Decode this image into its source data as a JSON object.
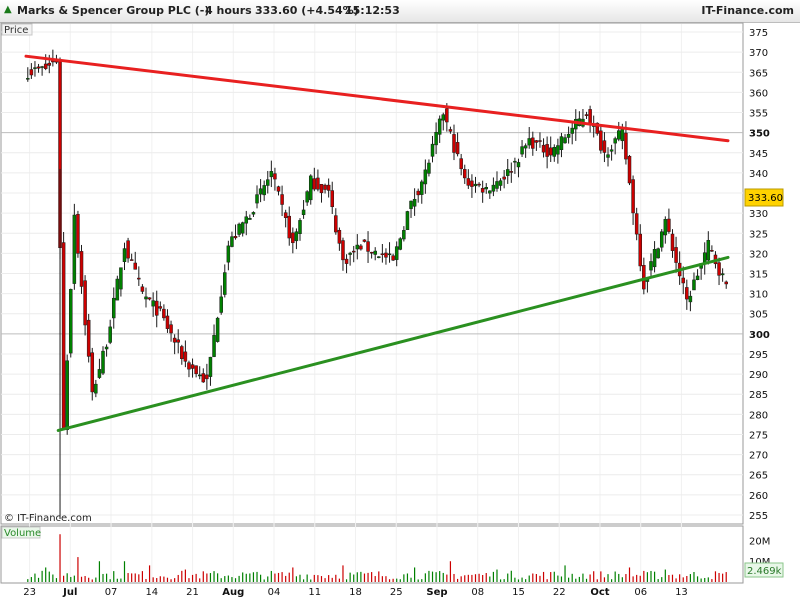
{
  "header": {
    "instrument": "Marks & Spencer Group PLC (-)",
    "timeframe": "4 hours",
    "price_change": "333.60 (+4.54%)",
    "time": "15:12:53",
    "brand": "IT-Finance.com",
    "watermark": "© IT-Finance.com"
  },
  "panels": {
    "price_label": "Price",
    "volume_label": "Volume"
  },
  "colors": {
    "up": "#008000",
    "down": "#cc0000",
    "resistance": "#e82020",
    "support": "#2a9020",
    "last_badge": "#ffd200",
    "vol_badge": "#e8f7e8"
  },
  "chart_data": {
    "type": "candlestick",
    "title": "Marks & Spencer Group PLC (-)",
    "timeframe": "4 hours",
    "last_price": "333.60",
    "change": "+4.54%",
    "ylim": [
      253,
      377
    ],
    "x_ticks": [
      "23",
      "Jul",
      "07",
      "14",
      "21",
      "Aug",
      "04",
      "11",
      "18",
      "25",
      "Sep",
      "08",
      "15",
      "22",
      "Oct",
      "06",
      "13"
    ],
    "y_ticks": [
      255,
      260,
      265,
      270,
      275,
      280,
      285,
      290,
      295,
      300,
      305,
      310,
      315,
      320,
      325,
      330,
      335,
      340,
      345,
      350,
      355,
      360,
      365,
      370,
      375
    ],
    "y_ticks_bold": [
      300,
      350
    ],
    "close_path_index": [
      0,
      5,
      8,
      10,
      13,
      18,
      22,
      27,
      32,
      37,
      44,
      50,
      56,
      62,
      68,
      74,
      79,
      84,
      88,
      93,
      98,
      102,
      106,
      111,
      116,
      122,
      128,
      134,
      140,
      146,
      151,
      156,
      161,
      166,
      172,
      178,
      184,
      190,
      196
    ],
    "close_path_values": [
      365,
      366,
      368,
      276,
      330,
      285,
      298,
      322,
      310,
      305,
      293,
      288,
      322,
      330,
      340,
      322,
      338,
      335,
      318,
      322,
      320,
      318,
      330,
      340,
      355,
      338,
      336,
      340,
      348,
      345,
      350,
      355,
      345,
      350,
      312,
      328,
      308,
      322,
      310
    ],
    "bars_total": 196,
    "trendlines": [
      {
        "name": "resistance",
        "start_index": 0,
        "start_value": 369,
        "end_index": 196,
        "end_value": 348
      },
      {
        "name": "support",
        "start_index": 9,
        "start_value": 276,
        "end_index": 196,
        "end_value": 319
      }
    ],
    "volume": {
      "axis_ticks": [
        "20M",
        "10M"
      ],
      "last": "2.469k",
      "spikes": [
        [
          9,
          23
        ],
        [
          5,
          7
        ],
        [
          14,
          12
        ],
        [
          20,
          10
        ],
        [
          27,
          10
        ],
        [
          34,
          8
        ],
        [
          44,
          6
        ],
        [
          74,
          7
        ],
        [
          88,
          8
        ],
        [
          108,
          7
        ],
        [
          118,
          10
        ],
        [
          131,
          6
        ],
        [
          150,
          8
        ],
        [
          168,
          7
        ],
        [
          178,
          6
        ]
      ],
      "base": [
        1.2,
        5.5
      ],
      "ylim": [
        0,
        26
      ]
    }
  }
}
